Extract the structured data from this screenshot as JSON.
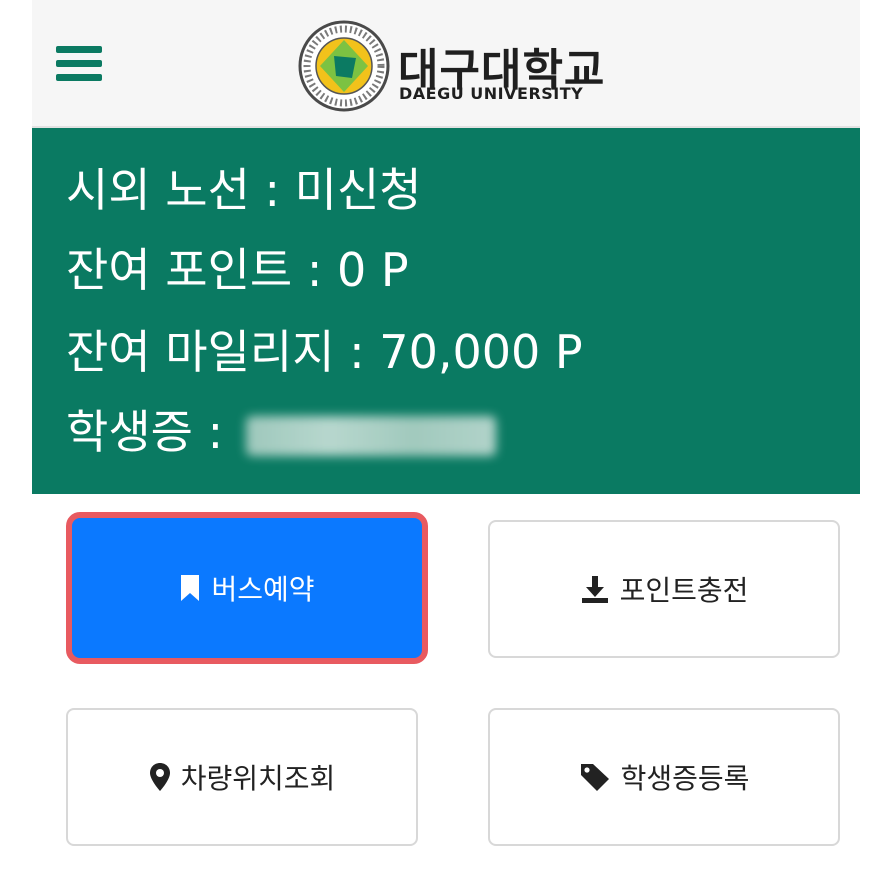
{
  "header": {
    "logo_korean": "대구대학교",
    "logo_english": "DAEGU UNIVERSITY"
  },
  "info": {
    "route_label": "시외 노선 : ",
    "route_value": "미신청",
    "points_label": "잔여 포인트 : ",
    "points_value": "0 P",
    "mileage_label": "잔여 마일리지 : ",
    "mileage_value": "70,000 P",
    "student_id_label": "학생증 : "
  },
  "buttons": {
    "bus_reservation": "버스예약",
    "point_charge": "포인트충전",
    "vehicle_location": "차량위치조회",
    "student_card_register": "학생증등록"
  },
  "colors": {
    "brand_green": "#0a7a62",
    "primary_blue": "#0b79ff",
    "highlight_red": "#e85a60"
  },
  "icons": [
    "menu-icon",
    "bookmark-icon",
    "download-icon",
    "map-marker-icon",
    "tag-icon"
  ]
}
